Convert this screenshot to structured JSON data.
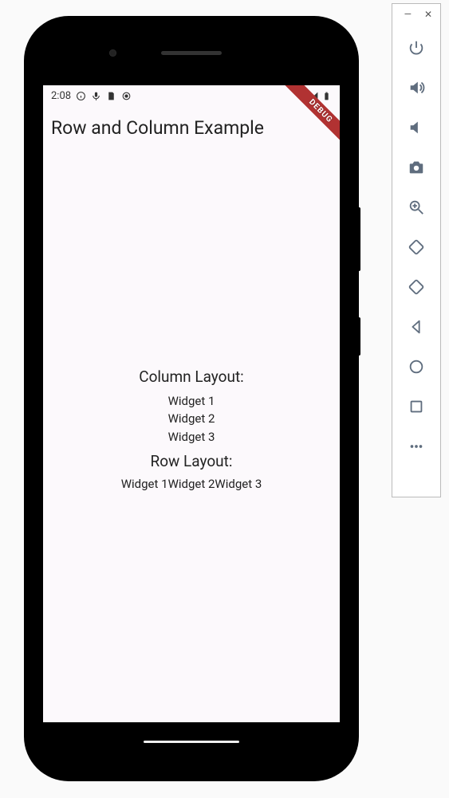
{
  "status_bar": {
    "time": "2:08"
  },
  "app": {
    "title": "Row and Column Example",
    "debug_label": "DEBUG",
    "sections": {
      "column_title": "Column Layout:",
      "column_items": {
        "i0": "Widget 1",
        "i1": "Widget 2",
        "i2": "Widget 3"
      },
      "row_title": "Row Layout:",
      "row_items": {
        "i0": "Widget 1",
        "i1": "Widget 2",
        "i2": "Widget 3"
      }
    }
  },
  "emu_window": {
    "minimize": "—",
    "close": "✕"
  }
}
